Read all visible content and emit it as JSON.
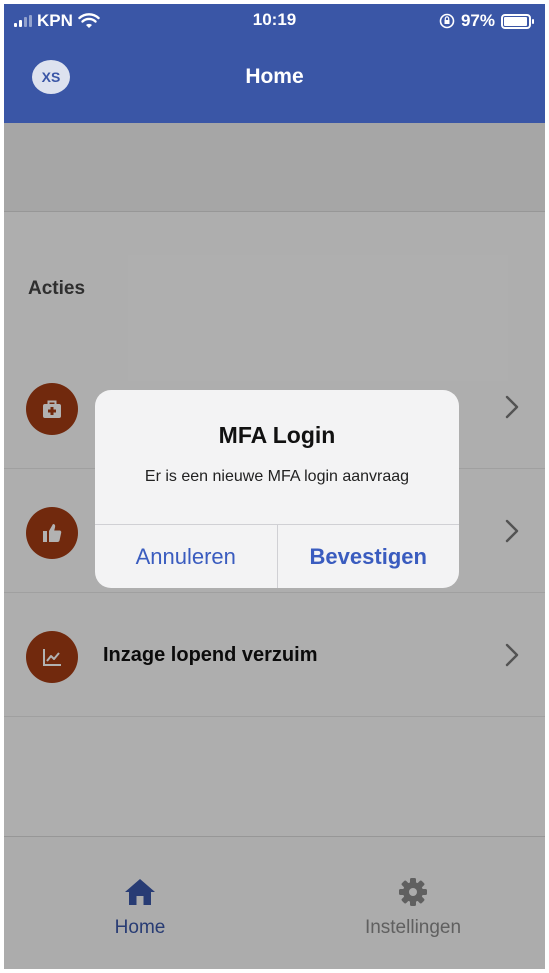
{
  "status_bar": {
    "carrier": "KPN",
    "time": "10:19",
    "battery_percent": "97%",
    "battery_level": 0.97
  },
  "header": {
    "logo_text": "XS",
    "title": "Home"
  },
  "main": {
    "section_title": "Acties",
    "rows": [
      {
        "label": "",
        "icon": "medical-kit-icon"
      },
      {
        "label": "",
        "icon": "thumbs-up-icon"
      },
      {
        "label": "Inzage lopend verzuim",
        "icon": "chart-line-icon"
      }
    ]
  },
  "tabbar": {
    "home_label": "Home",
    "settings_label": "Instellingen",
    "active": "Home"
  },
  "dialog": {
    "title": "MFA Login",
    "message": "Er is een nieuwe MFA login aanvraag",
    "cancel_label": "Annuleren",
    "confirm_label": "Bevestigen"
  },
  "colors": {
    "brand": "#3a56a6",
    "action_icon": "#a23b14",
    "dialog_button": "#3a5cbf"
  }
}
